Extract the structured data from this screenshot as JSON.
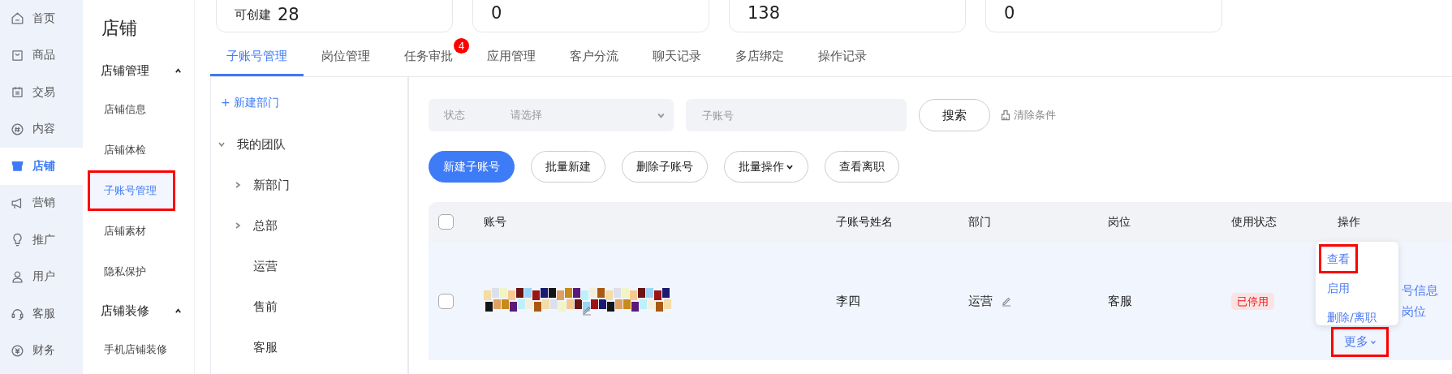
{
  "nav": [
    {
      "label": "首页",
      "selected": false
    },
    {
      "label": "商品",
      "selected": false
    },
    {
      "label": "交易",
      "selected": false
    },
    {
      "label": "内容",
      "selected": false
    },
    {
      "label": "店铺",
      "selected": true
    },
    {
      "label": "营销",
      "selected": false
    },
    {
      "label": "推广",
      "selected": false
    },
    {
      "label": "用户",
      "selected": false
    },
    {
      "label": "客服",
      "selected": false
    },
    {
      "label": "财务",
      "selected": false
    }
  ],
  "sidebar": {
    "title": "店铺",
    "groups": [
      {
        "label": "店铺管理",
        "expanded": true,
        "items": [
          {
            "label": "店铺信息",
            "selected": false,
            "highlighted": false
          },
          {
            "label": "店铺体检",
            "selected": false,
            "highlighted": false
          },
          {
            "label": "子账号管理",
            "selected": true,
            "highlighted": true
          },
          {
            "label": "店铺素材",
            "selected": false,
            "highlighted": false
          },
          {
            "label": "隐私保护",
            "selected": false,
            "highlighted": false
          }
        ]
      },
      {
        "label": "店铺装修",
        "expanded": true,
        "items": [
          {
            "label": "手机店铺装修",
            "selected": false,
            "highlighted": false
          }
        ]
      }
    ]
  },
  "stats": [
    {
      "label": "可创建",
      "value": "28"
    },
    {
      "value": "0"
    },
    {
      "value": "138"
    },
    {
      "value": "0"
    }
  ],
  "tabs": [
    {
      "label": "子账号管理",
      "selected": true
    },
    {
      "label": "岗位管理",
      "selected": false
    },
    {
      "label": "任务审批",
      "selected": false,
      "badge": "4"
    },
    {
      "label": "应用管理",
      "selected": false
    },
    {
      "label": "客户分流",
      "selected": false
    },
    {
      "label": "聊天记录",
      "selected": false
    },
    {
      "label": "多店绑定",
      "selected": false
    },
    {
      "label": "操作记录",
      "selected": false
    }
  ],
  "departments": {
    "add": "+ 新建部门",
    "tree": [
      {
        "label": "我的团队",
        "expanded": true,
        "children": [
          {
            "label": "新部门",
            "expanded": false
          },
          {
            "label": "总部",
            "expanded": false
          },
          {
            "label": "运营"
          },
          {
            "label": "售前"
          },
          {
            "label": "客服"
          }
        ]
      }
    ]
  },
  "filters": {
    "status_label": "状态",
    "status_placeholder": "请选择",
    "account_placeholder": "子账号",
    "search": "搜索",
    "clear": "清除条件"
  },
  "toolbar": [
    {
      "label": "新建子账号",
      "kind": "primary"
    },
    {
      "label": "批量新建",
      "kind": "plain"
    },
    {
      "label": "删除子账号",
      "kind": "plain"
    },
    {
      "label": "批量操作",
      "kind": "dropdown"
    },
    {
      "label": "查看离职",
      "kind": "plain"
    }
  ],
  "table": {
    "header_checked": false,
    "columns": [
      "账号",
      "子账号姓名",
      "部门",
      "岗位",
      "使用状态",
      "操作"
    ],
    "rows": [
      {
        "checked": false,
        "name": "李四",
        "department": "运营",
        "position": "客服",
        "status": "已停用",
        "actions": [
          "号信息",
          "岗位"
        ],
        "more": "更多",
        "more_highlighted": true
      }
    ]
  },
  "menu": {
    "items": [
      {
        "label": "查看",
        "highlighted": true
      },
      {
        "label": "启用",
        "highlighted": false
      },
      {
        "label": "删除/离职",
        "highlighted": false
      }
    ]
  }
}
